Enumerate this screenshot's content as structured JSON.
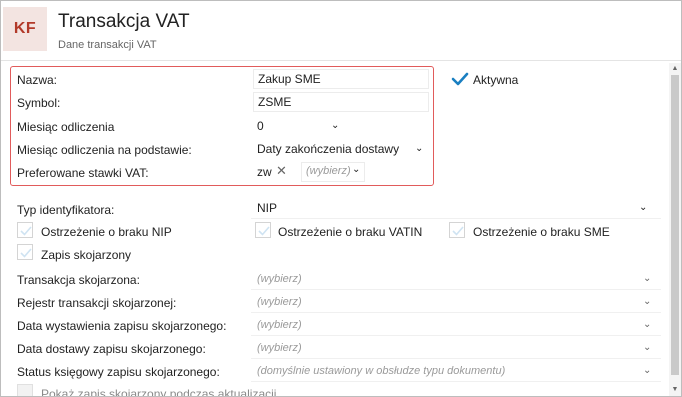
{
  "header": {
    "logo_text": "KF",
    "title": "Transakcja VAT",
    "subtitle": "Dane transakcji VAT"
  },
  "form": {
    "nazwa": {
      "label": "Nazwa:",
      "value": "Zakup SME"
    },
    "symbol": {
      "label": "Symbol:",
      "value": "ZSME"
    },
    "miesiac_odliczenia": {
      "label": "Miesiąc odliczenia",
      "value": "0"
    },
    "miesiac_podstawa": {
      "label": "Miesiąc odliczenia na podstawie:",
      "value": "Daty zakończenia dostawy"
    },
    "stawki_vat": {
      "label": "Preferowane stawki VAT:",
      "tag": "zw",
      "placeholder": "(wybierz)"
    },
    "aktywna": {
      "label": "Aktywna",
      "checked": true
    },
    "typ_identyfikatora": {
      "label": "Typ identyfikatora:",
      "value": "NIP"
    },
    "checks": {
      "brak_nip": {
        "label": "Ostrzeżenie o braku NIP",
        "checked": false
      },
      "brak_vatin": {
        "label": "Ostrzeżenie o braku VATIN",
        "checked": false
      },
      "brak_sme": {
        "label": "Ostrzeżenie o braku SME",
        "checked": false
      },
      "zapis_skojarzony": {
        "label": "Zapis skojarzony",
        "checked": false
      }
    },
    "transakcja_skojarzona": {
      "label": "Transakcja skojarzona:",
      "placeholder": "(wybierz)"
    },
    "rejestr": {
      "label": "Rejestr transakcji skojarzonej:",
      "placeholder": "(wybierz)"
    },
    "data_wystawienia": {
      "label": "Data wystawienia zapisu skojarzonego:",
      "placeholder": "(wybierz)"
    },
    "data_dostawy": {
      "label": "Data dostawy zapisu skojarzonego:",
      "placeholder": "(wybierz)"
    },
    "status_ksiegowy": {
      "label": "Status księgowy zapisu skojarzonego:",
      "placeholder": "(domyślnie ustawiony w obsłudze typu dokumentu)"
    },
    "pokaz_zapis": {
      "label": "Pokaż zapis skojarzony podczas aktualizacji"
    }
  },
  "colors": {
    "accent_red": "#e15b5b",
    "logo_bg": "#f3e4e1",
    "logo_text": "#b23a2a",
    "check_blue": "#1a7fc1"
  }
}
